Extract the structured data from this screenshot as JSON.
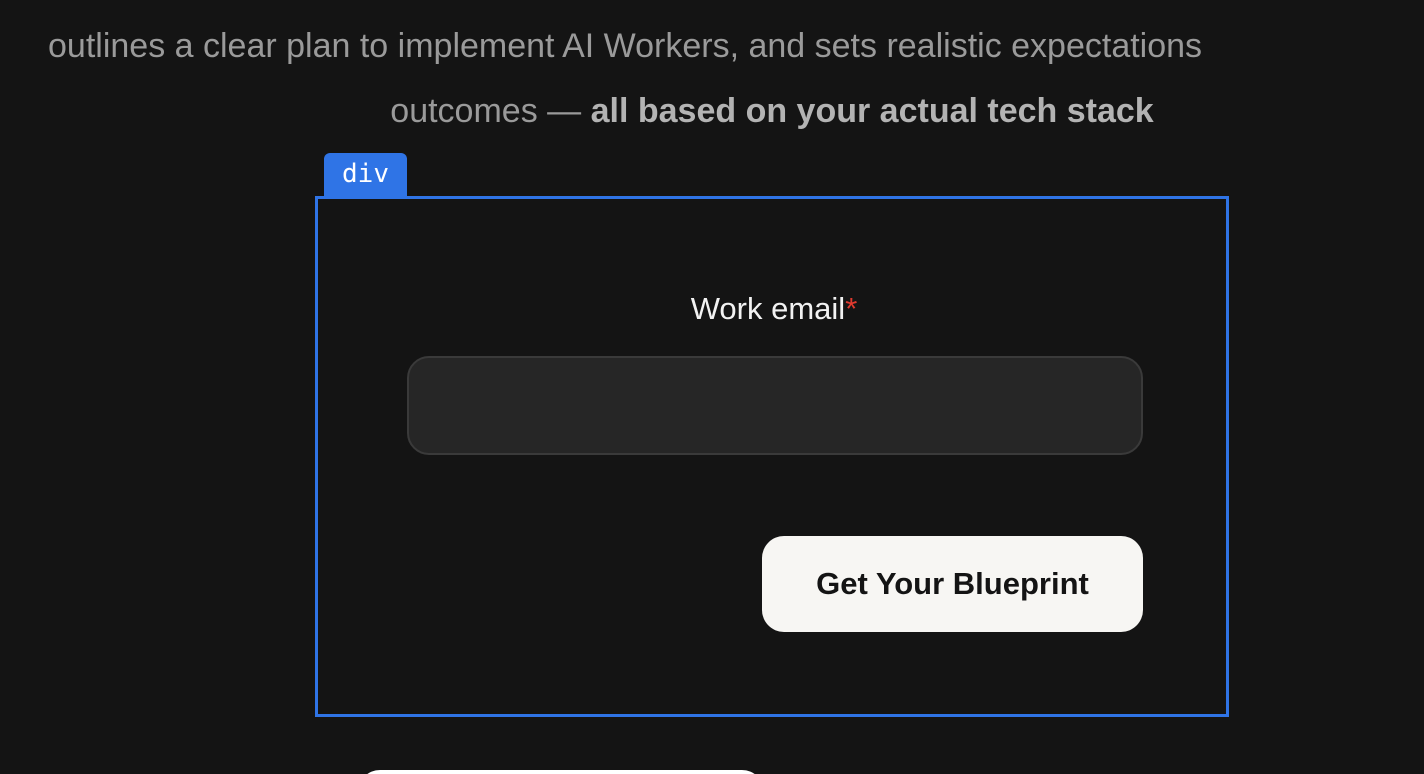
{
  "intro": {
    "line1": "outlines a clear plan to implement AI Workers, and sets realistic expectations",
    "line2_normal": "outcomes — ",
    "line2_bold": "all based on your actual tech stack"
  },
  "inspector": {
    "badge_label": "div",
    "accent_color": "#2f74e6"
  },
  "form": {
    "email_label": "Work email",
    "required_marker": "*",
    "email_value": "",
    "submit_label": "Get Your Blueprint"
  }
}
